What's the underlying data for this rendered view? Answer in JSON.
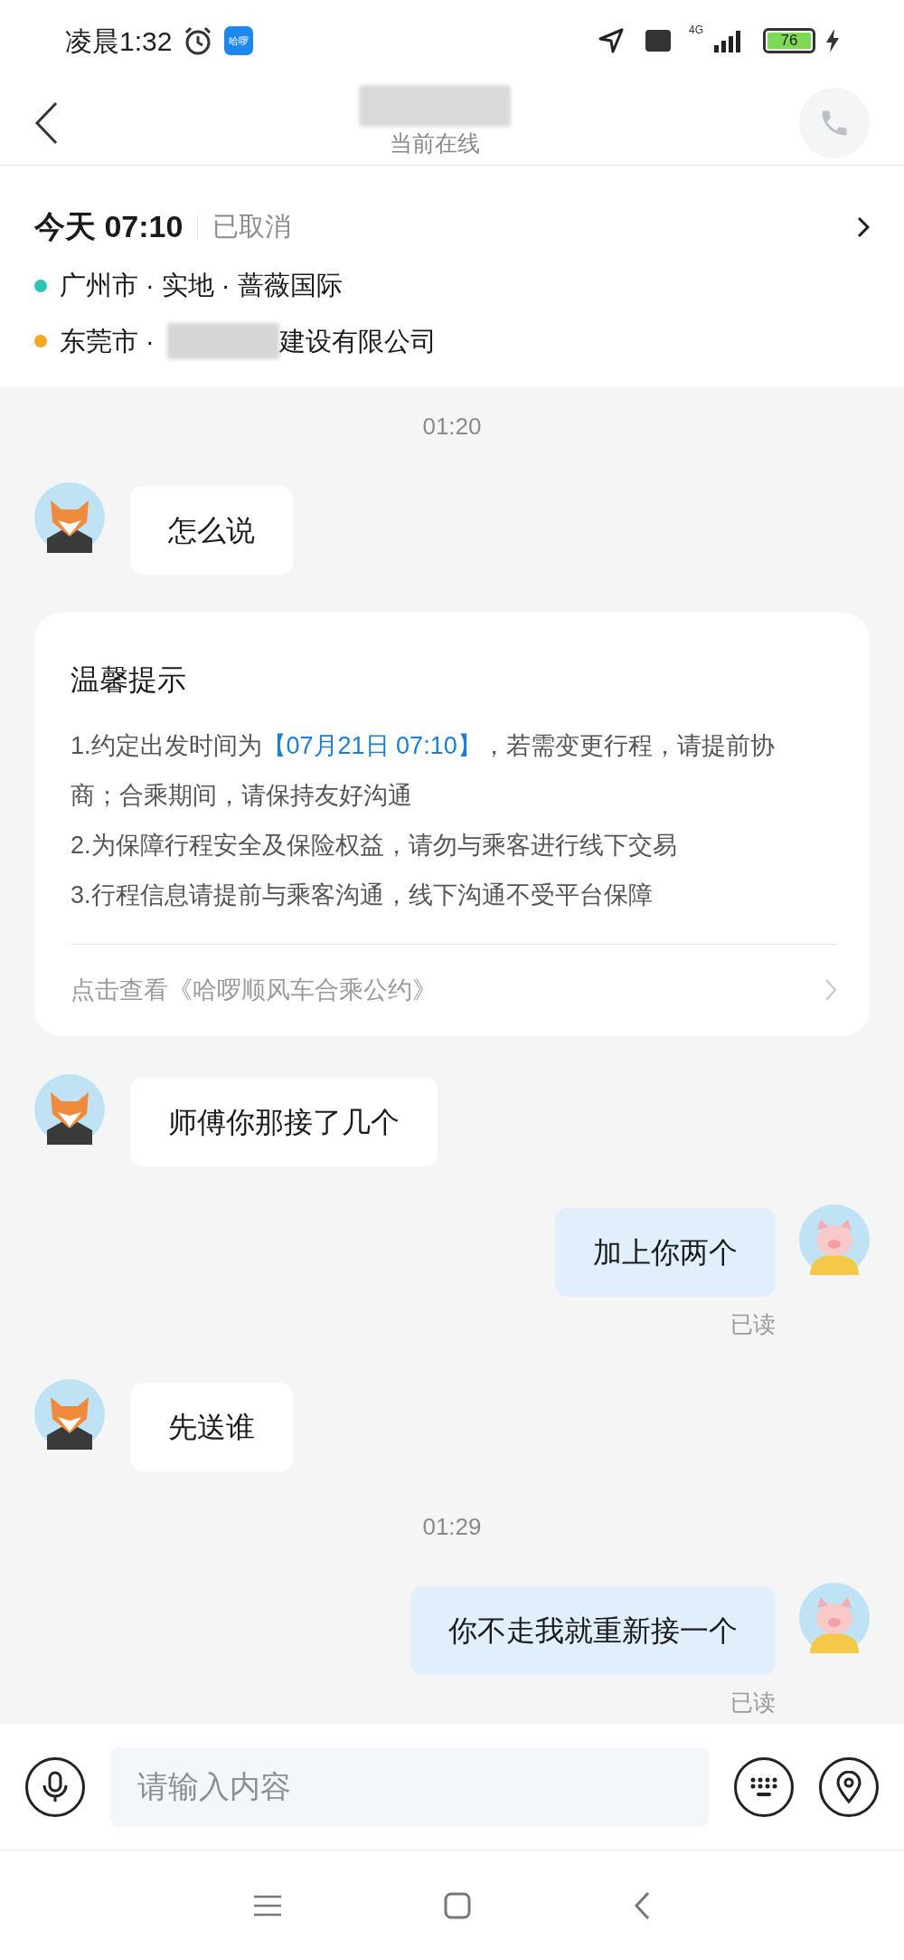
{
  "status_bar": {
    "time": "凌晨1:32",
    "app_badge": "哈啰",
    "network": "4G",
    "battery": "76"
  },
  "header": {
    "subtitle": "当前在线"
  },
  "trip": {
    "date": "今天 07:10",
    "status": "已取消",
    "stops": [
      {
        "text": "广州市 · 实地 · 蔷薇国际",
        "color": "#2ec4b6",
        "kind": "plain"
      },
      {
        "city": "东莞市 ·",
        "text": "建设有限公司",
        "color": "#f5a623",
        "kind": "partly-hidden"
      }
    ]
  },
  "chat": [
    {
      "kind": "time",
      "text": "01:20"
    },
    {
      "kind": "incoming",
      "text": "怎么说"
    },
    {
      "kind": "notice",
      "title": "温馨提示",
      "lines": [
        "1.约定出发时间为**【07月21日 07:10】**，若需变更行程，请提前协商；合乘期间，请保持友好沟通",
        "2.为保障行程安全及保险权益，请勿与乘客进行线下交易",
        "3.行程信息请提前与乘客沟通，线下沟通不受平台保障"
      ],
      "link": "点击查看《哈啰顺风车合乘公约》"
    },
    {
      "kind": "incoming",
      "text": "师傅你那接了几个"
    },
    {
      "kind": "outgoing",
      "text": "加上你两个",
      "receipt": "已读"
    },
    {
      "kind": "incoming",
      "text": "先送谁"
    },
    {
      "kind": "time",
      "text": "01:29"
    },
    {
      "kind": "outgoing",
      "text": "你不走我就重新接一个",
      "receipt": "已读"
    }
  ],
  "composer": {
    "placeholder": "请输入内容"
  }
}
